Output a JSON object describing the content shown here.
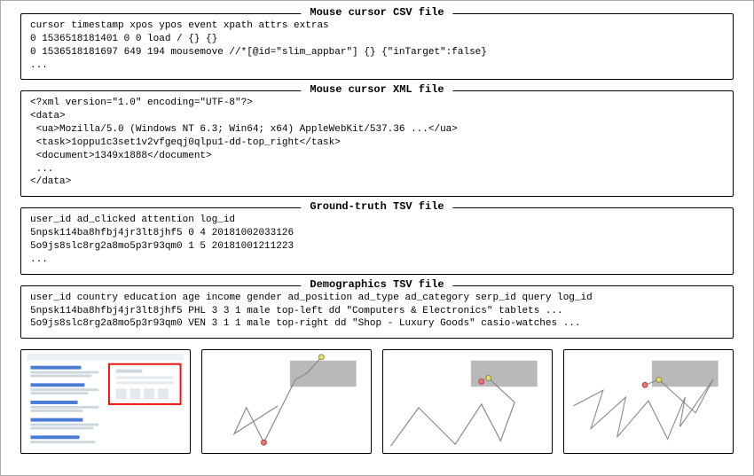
{
  "blocks": {
    "csv": {
      "title": "Mouse cursor CSV file",
      "content": "cursor timestamp xpos ypos event xpath attrs extras\n0 1536518181401 0 0 load / {} {}\n0 1536518181697 649 194 mousemove //*[@id=\"slim_appbar\"] {} {\"inTarget\":false}\n..."
    },
    "xml": {
      "title": "Mouse cursor XML file",
      "content": "<?xml version=\"1.0\" encoding=\"UTF-8\"?>\n<data>\n <ua>Mozilla/5.0 (Windows NT 6.3; Win64; x64) AppleWebKit/537.36 ...</ua>\n <task>1oppu1c3set1v2vfgeqj0qlpu1-dd-top_right</task>\n <document>1349x1888</document>\n ...\n</data>"
    },
    "gt": {
      "title": "Ground-truth TSV file",
      "content": "user_id ad_clicked attention log_id\n5npsk114ba8hfbj4jr3lt8jhf5 0 4 20181002033126\n5o9js8slc8rg2a8mo5p3r93qm0 1 5 20181001211223\n..."
    },
    "demo": {
      "title": "Demographics TSV file",
      "content": "user_id country education age income gender ad_position ad_type ad_category serp_id query log_id\n5npsk114ba8hfbj4jr3lt8jhf5 PHL 3 3 1 male top-left dd \"Computers & Electronics\" tablets ...\n5o9js8slc8rg2a8mo5p3r93qm0 VEN 3 1 1 male top-right dd \"Shop - Luxury Goods\" casio-watches ..."
    }
  }
}
